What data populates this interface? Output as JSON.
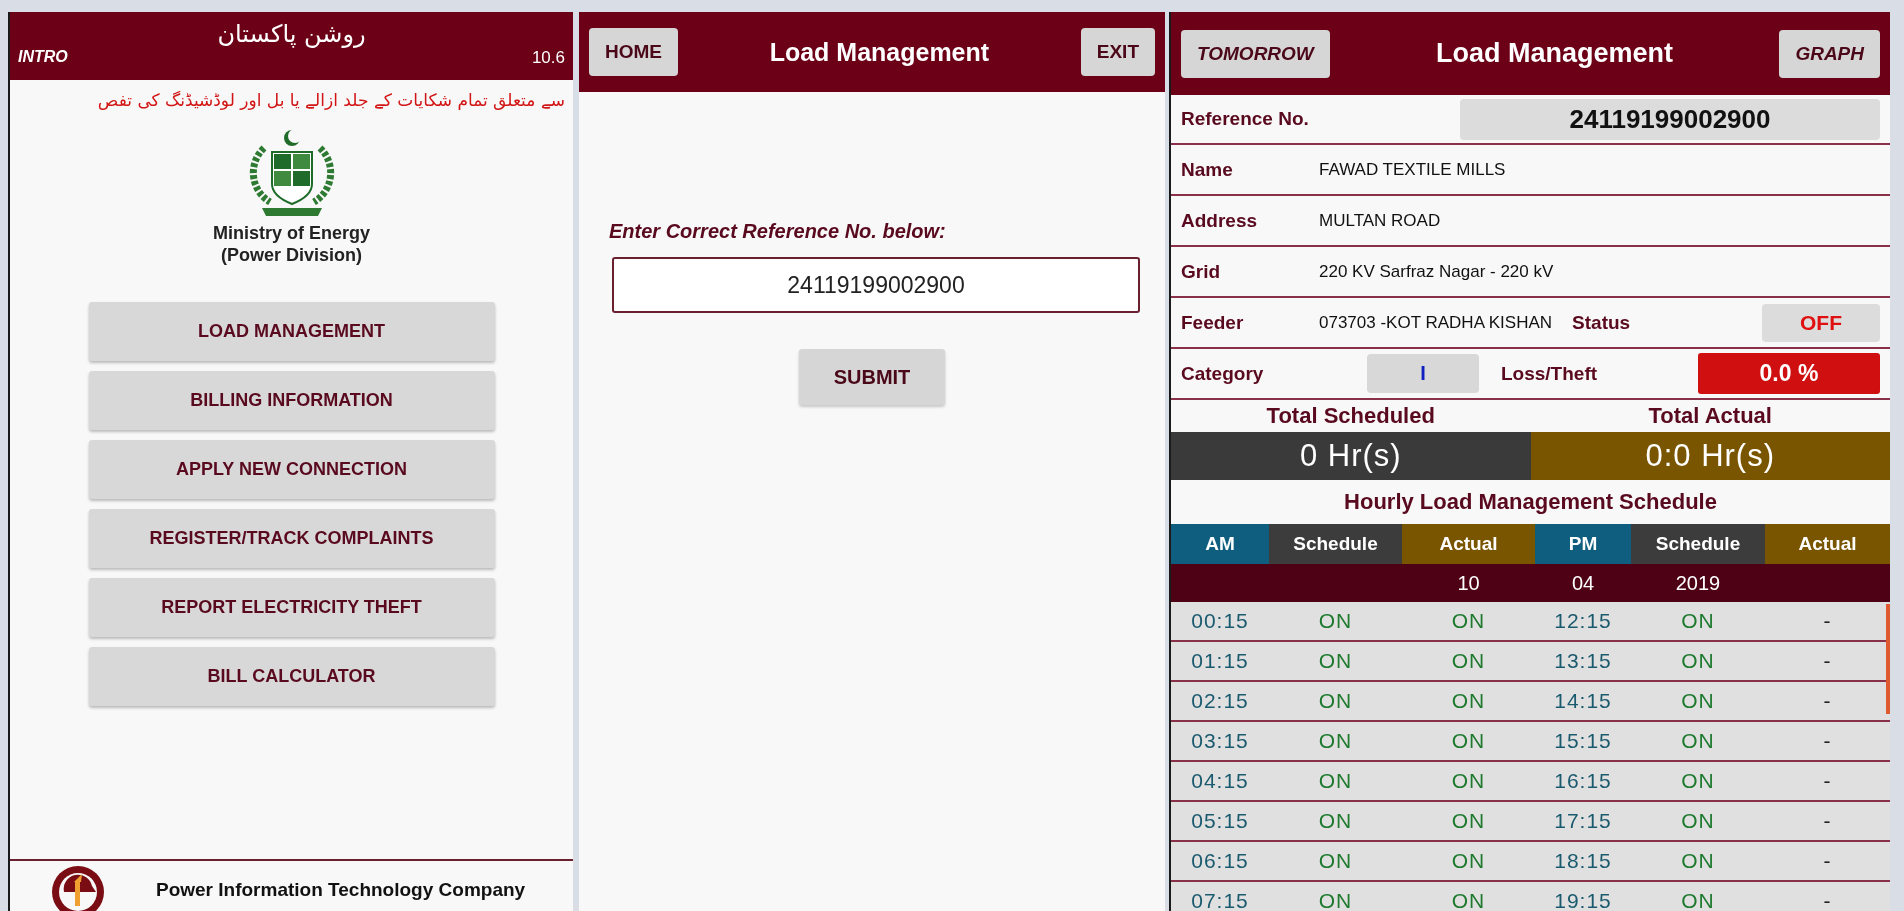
{
  "intro_screen": {
    "title": "روشن پاکستان",
    "label": "INTRO",
    "version": "10.6",
    "marquee": "سے متعلق تمام شکایات کے جلد ازالے یا بل اور لوڈشیڈنگ کی تفص",
    "organization": [
      "Ministry of Energy",
      "(Power Division)"
    ],
    "menu": [
      "LOAD MANAGEMENT",
      "BILLING INFORMATION",
      "APPLY NEW CONNECTION",
      "REGISTER/TRACK COMPLAINTS",
      "REPORT ELECTRICITY THEFT",
      "BILL CALCULATOR"
    ],
    "footer": "Power Information Technology Company"
  },
  "reference_screen": {
    "left_button": "HOME",
    "title": "Load Management",
    "right_button": "EXIT",
    "prompt": "Enter Correct Reference No. below:",
    "reference_field": {
      "value": "24119199002900"
    },
    "submit": "SUBMIT"
  },
  "schedule_screen": {
    "left_button": "TOMORROW",
    "title": "Load Management",
    "right_button": "GRAPH",
    "reference": {
      "label": "Reference No.",
      "value": "24119199002900"
    },
    "details": [
      {
        "label": "Name",
        "value": "FAWAD TEXTILE MILLS"
      },
      {
        "label": "Address",
        "value": "MULTAN ROAD"
      },
      {
        "label": "Grid",
        "value": "220 KV Sarfraz Nagar - 220 kV"
      }
    ],
    "feeder": {
      "label": "Feeder",
      "value": "073703 -KOT RADHA KISHAN",
      "status_label": "Status",
      "status": "OFF"
    },
    "category": {
      "label": "Category",
      "value": "I",
      "loss_label": "Loss/Theft",
      "loss": "0.0 %"
    },
    "totals": [
      {
        "label": "Total Scheduled",
        "value": "0 Hr(s)",
        "kind": "scheduled"
      },
      {
        "label": "Total Actual",
        "value": "0:0 Hr(s)",
        "kind": "actual"
      }
    ],
    "schedule": {
      "title": "Hourly Load Management Schedule",
      "columns": [
        {
          "label": "AM",
          "kind": "period"
        },
        {
          "label": "Schedule",
          "kind": "schedule"
        },
        {
          "label": "Actual",
          "kind": "actual"
        },
        {
          "label": "PM",
          "kind": "period"
        },
        {
          "label": "Schedule",
          "kind": "schedule"
        },
        {
          "label": "Actual",
          "kind": "actual"
        }
      ],
      "date": [
        "10",
        "04",
        "2019"
      ],
      "rows": [
        [
          "00:15",
          "ON",
          "ON",
          "12:15",
          "ON",
          "-"
        ],
        [
          "01:15",
          "ON",
          "ON",
          "13:15",
          "ON",
          "-"
        ],
        [
          "02:15",
          "ON",
          "ON",
          "14:15",
          "ON",
          "-"
        ],
        [
          "03:15",
          "ON",
          "ON",
          "15:15",
          "ON",
          "-"
        ],
        [
          "04:15",
          "ON",
          "ON",
          "16:15",
          "ON",
          "-"
        ],
        [
          "05:15",
          "ON",
          "ON",
          "17:15",
          "ON",
          "-"
        ],
        [
          "06:15",
          "ON",
          "ON",
          "18:15",
          "ON",
          "-"
        ],
        [
          "07:15",
          "ON",
          "ON",
          "19:15",
          "ON",
          "-"
        ]
      ]
    }
  }
}
